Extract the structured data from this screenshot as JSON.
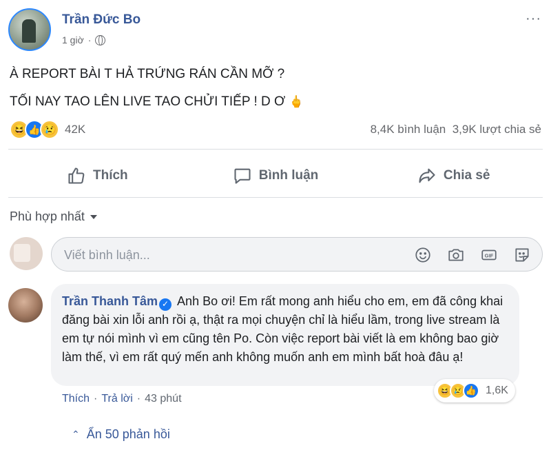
{
  "post": {
    "author": "Trần Đức Bo",
    "time": "1 giờ",
    "separator": "·",
    "line1": "À REPORT BÀI T HẢ TRỨNG RÁN CẦN MỠ ?",
    "line2": "TỐI NAY TAO LÊN LIVE TAO CHỬI TIẾP ! D Ơ",
    "line2_emoji": "🖕",
    "reactions_count": "42K",
    "comments": "8,4K bình luận",
    "shares": "3,9K lượt chia sẻ"
  },
  "actions": {
    "like": "Thích",
    "comment": "Bình luận",
    "share": "Chia sẻ"
  },
  "sort": {
    "label": "Phù hợp nhất"
  },
  "compose": {
    "placeholder": "Viết bình luận..."
  },
  "comment": {
    "name": "Trần Thanh Tâm",
    "text": "Anh Bo ơi! Em rất mong anh hiểu cho em, em đã công khai đăng bài xin lỗi anh rồi ạ, thật ra mọi chuyện chỉ là hiểu lầm, trong live stream là em tự nói mình vì em cũng tên Po. Còn việc report bài viết là em không bao giờ làm thế, vì em rất quý mến anh không muốn anh em mình bất hoà đâu ạ!",
    "reactions_count": "1,6K",
    "like": "Thích",
    "reply": "Trả lời",
    "time": "43 phút",
    "separator": "·"
  },
  "replies": {
    "label": "Ẩn 50 phản hồi"
  },
  "icons": {
    "reaction_haha": "😆",
    "reaction_like": "👍",
    "reaction_sad": "😢",
    "verified": "✓",
    "chevron_up": "⌃",
    "more": "···"
  },
  "colors": {
    "link_blue": "#385898",
    "fb_blue": "#1877f2",
    "muted": "#65676b"
  }
}
